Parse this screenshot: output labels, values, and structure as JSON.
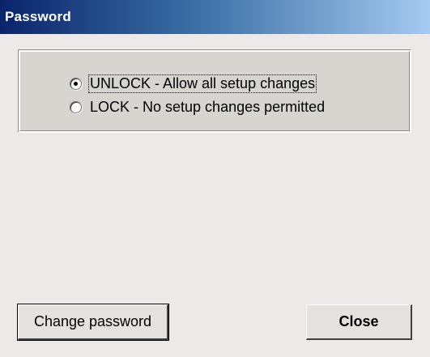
{
  "window": {
    "title": "Password"
  },
  "lock_options": {
    "selected": "unlock",
    "items": [
      {
        "id": "unlock",
        "label": "UNLOCK - Allow all setup changes",
        "checked": true
      },
      {
        "id": "lock",
        "label": "LOCK - No setup changes permitted",
        "checked": false
      }
    ]
  },
  "buttons": {
    "change_password_label": "Change password",
    "close_label": "Close"
  },
  "colors": {
    "titlebar_start": "#0a246a",
    "titlebar_end": "#a6caf0",
    "dialog_background": "#ece9e8",
    "groupbox_background": "#d8d4d0",
    "button_face": "#e6e2e0"
  }
}
